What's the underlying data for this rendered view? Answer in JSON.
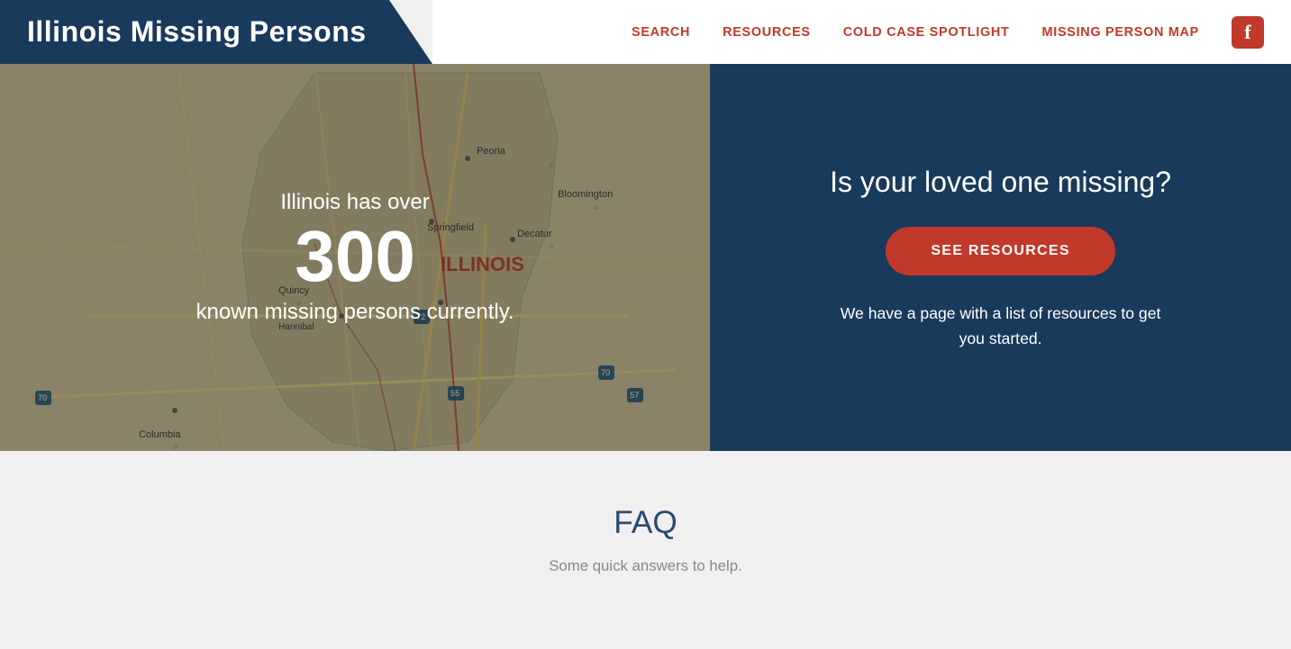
{
  "header": {
    "logo_text": "Illinois Missing Persons",
    "nav": {
      "search": "SEARCH",
      "resources": "RESOURCES",
      "cold_case": "COLD CASE SPOTLIGHT",
      "map": "MISSING PERSON MAP"
    },
    "facebook_label": "f"
  },
  "hero": {
    "map_over": "Illinois has over",
    "map_number": "300",
    "map_sub": "known missing persons currently.",
    "right_heading": "Is your loved one missing?",
    "cta_button": "SEE RESOURCES",
    "right_body": "We have a page with a list of resources to get you started."
  },
  "faq": {
    "title": "FAQ",
    "subtitle": "Some quick answers to help."
  },
  "colors": {
    "header_bg": "#1a3a5c",
    "hero_right_bg": "#1a3a5c",
    "cta_bg": "#c0392b",
    "nav_link": "#c0392b"
  }
}
